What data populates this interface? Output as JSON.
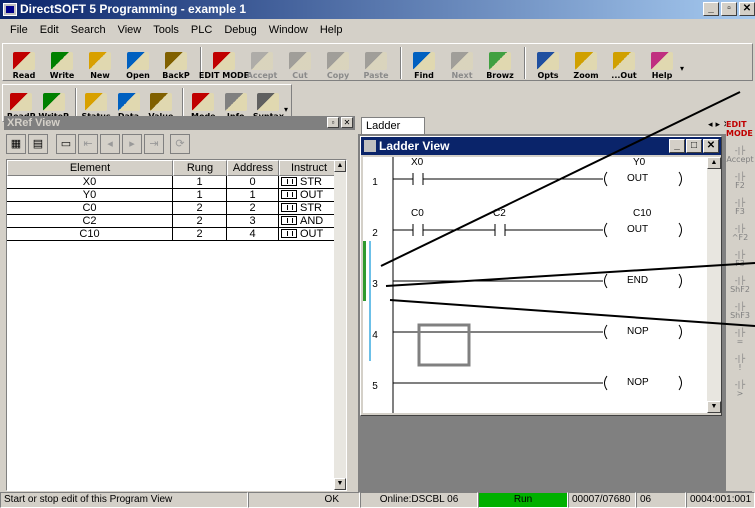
{
  "window": {
    "title": "DirectSOFT 5 Programming - example 1"
  },
  "menu": [
    "File",
    "Edit",
    "Search",
    "View",
    "Tools",
    "PLC",
    "Debug",
    "Window",
    "Help"
  ],
  "toolbar1": [
    {
      "label": "Read",
      "icon": "read-icon",
      "enabled": true
    },
    {
      "label": "Write",
      "icon": "write-icon",
      "enabled": true
    },
    {
      "label": "New",
      "icon": "new-icon",
      "enabled": true
    },
    {
      "label": "Open",
      "icon": "open-icon",
      "enabled": true
    },
    {
      "label": "BackP",
      "icon": "backup-icon",
      "enabled": true
    },
    {
      "label": "EDIT MODE",
      "icon": "edit-mode-icon",
      "enabled": true
    },
    {
      "label": "Accept",
      "icon": "accept-icon",
      "enabled": false
    },
    {
      "label": "Cut",
      "icon": "cut-icon",
      "enabled": false
    },
    {
      "label": "Copy",
      "icon": "copy-icon",
      "enabled": false
    },
    {
      "label": "Paste",
      "icon": "paste-icon",
      "enabled": false
    },
    {
      "label": "Find",
      "icon": "find-icon",
      "enabled": true
    },
    {
      "label": "Next",
      "icon": "next-icon",
      "enabled": false
    },
    {
      "label": "Browz",
      "icon": "browse-icon",
      "enabled": true
    },
    {
      "label": "Opts",
      "icon": "options-icon",
      "enabled": true
    },
    {
      "label": "Zoom",
      "icon": "zoom-icon",
      "enabled": true
    },
    {
      "label": "...Out",
      "icon": "zoom-out-icon",
      "enabled": true
    },
    {
      "label": "Help",
      "icon": "help-icon",
      "enabled": true
    }
  ],
  "toolbar2": [
    {
      "label": "ReadP",
      "icon": "read-program-icon"
    },
    {
      "label": "WriteP",
      "icon": "write-program-icon"
    },
    {
      "label": "Status",
      "icon": "status-icon"
    },
    {
      "label": "Data",
      "icon": "data-icon"
    },
    {
      "label": "Value",
      "icon": "value-icon"
    },
    {
      "label": "Mode",
      "icon": "mode-icon"
    },
    {
      "label": "Info",
      "icon": "info-icon"
    },
    {
      "label": "Syntax",
      "icon": "syntax-icon"
    }
  ],
  "xref": {
    "title": "XRef View",
    "columns": [
      "Element",
      "Rung",
      "Address",
      "Instruct"
    ],
    "rows": [
      {
        "element": "X0",
        "rung": "1",
        "address": "0",
        "instruct": "STR"
      },
      {
        "element": "Y0",
        "rung": "1",
        "address": "1",
        "instruct": "OUT"
      },
      {
        "element": "C0",
        "rung": "2",
        "address": "2",
        "instruct": "STR"
      },
      {
        "element": "C2",
        "rung": "2",
        "address": "3",
        "instruct": "AND"
      },
      {
        "element": "C10",
        "rung": "2",
        "address": "4",
        "instruct": "OUT"
      }
    ]
  },
  "ladder": {
    "tab": "Ladder View",
    "title": "Ladder View",
    "rungs": [
      {
        "num": "1",
        "contacts": [
          "X0"
        ],
        "coil_addr": "Y0",
        "coil": "OUT"
      },
      {
        "num": "2",
        "contacts": [
          "C0",
          "C2"
        ],
        "coil_addr": "C10",
        "coil": "OUT"
      },
      {
        "num": "3",
        "contacts": [],
        "coil_addr": "",
        "coil": "END"
      },
      {
        "num": "4",
        "contacts": [],
        "coil_addr": "",
        "coil": "NOP"
      },
      {
        "num": "5",
        "contacts": [],
        "coil_addr": "",
        "coil": "NOP"
      }
    ]
  },
  "instruction_bar": [
    {
      "label": "EDIT MODE",
      "emph": true
    },
    {
      "label": "Accept",
      "emph": false
    },
    {
      "label": "F2",
      "emph": false
    },
    {
      "label": "F3",
      "emph": false
    },
    {
      "label": "^F2",
      "emph": false
    },
    {
      "label": "F3",
      "emph": false
    },
    {
      "label": "ShF2",
      "emph": false
    },
    {
      "label": "ShF3",
      "emph": false
    },
    {
      "label": "=",
      "emph": false
    },
    {
      "label": "!",
      "emph": false
    },
    {
      "label": ">",
      "emph": false
    }
  ],
  "status": {
    "hint": "Start or stop edit of this Program View",
    "ok": "OK",
    "online": "Online:DSCBL 06",
    "mode": "Run",
    "memory": "00007/07680",
    "plc_type": "06",
    "position": "0004:001:001"
  },
  "colors": {
    "run": "#00b000",
    "title_active": "#0a246a",
    "edit_mode": "#c00000"
  }
}
